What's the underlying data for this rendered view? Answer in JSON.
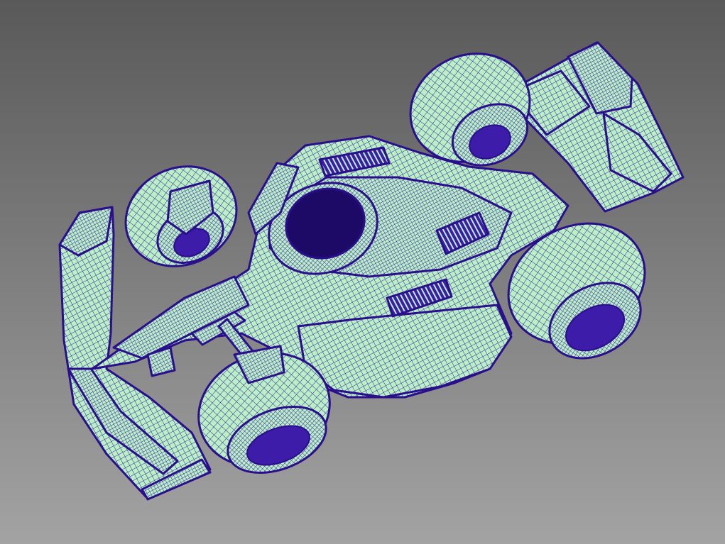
{
  "viewport": {
    "background_top": "#595959",
    "background_bottom": "#a3a3a3"
  },
  "model": {
    "kind": "race-car-surface-mesh",
    "surface_color": "#b9f0c4",
    "wire_color": "#3c1ca8",
    "outline_color": "#2a0e8c",
    "shadow_color": "#1c0a66"
  }
}
